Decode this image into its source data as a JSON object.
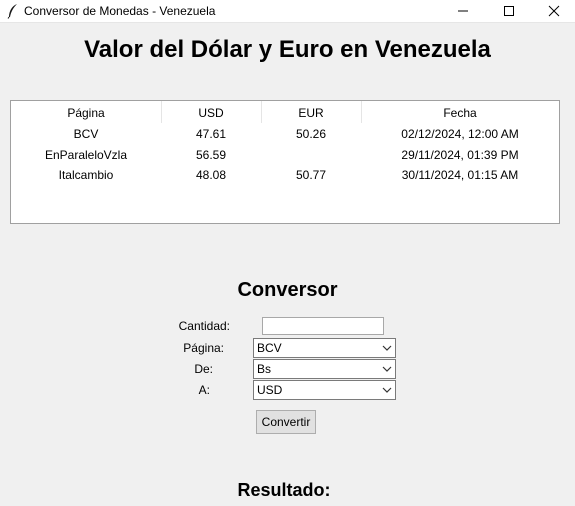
{
  "window": {
    "title": "Conversor de Monedas - Venezuela"
  },
  "heading": "Valor del Dólar y Euro en Venezuela",
  "table": {
    "columns": [
      "Página",
      "USD",
      "EUR",
      "Fecha"
    ],
    "rows": [
      [
        "BCV",
        "47.61",
        "50.26",
        "02/12/2024, 12:00 AM"
      ],
      [
        "EnParaleloVzla",
        "56.59",
        "",
        "29/11/2024, 01:39 PM"
      ],
      [
        "Italcambio",
        "48.08",
        "50.77",
        "30/11/2024, 01:15 AM"
      ]
    ]
  },
  "converter": {
    "title": "Conversor",
    "cantidad_label": "Cantidad:",
    "cantidad_value": "",
    "pagina_label": "Página:",
    "pagina_value": "BCV",
    "de_label": "De:",
    "de_value": "Bs",
    "a_label": "A:",
    "a_value": "USD",
    "button_label": "Convertir"
  },
  "result_label": "Resultado:"
}
